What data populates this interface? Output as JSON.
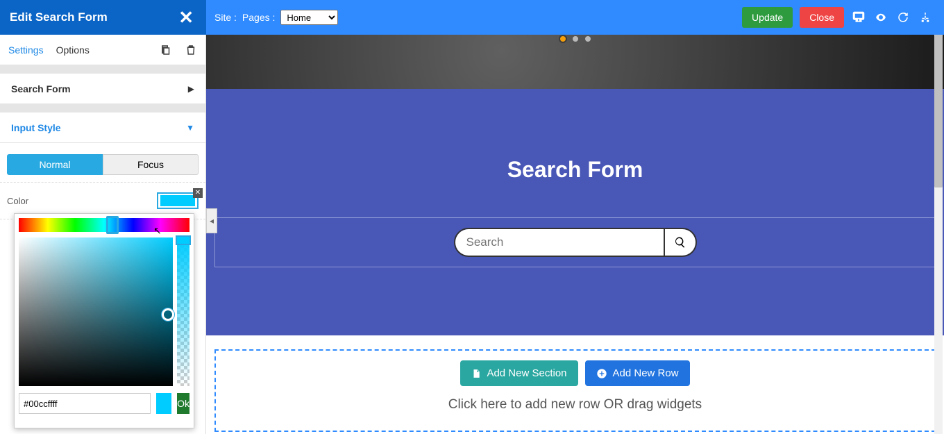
{
  "topbar": {
    "panel_title": "Edit Search Form",
    "site_label": "Site :",
    "pages_label": "Pages :",
    "page_select": "Home",
    "update_btn": "Update",
    "close_btn": "Close"
  },
  "left": {
    "tab_settings": "Settings",
    "tab_options": "Options",
    "section_search_form": "Search Form",
    "section_input_style": "Input Style",
    "seg_normal": "Normal",
    "seg_focus": "Focus",
    "color_label": "Color",
    "picker": {
      "hex": "#00ccffff",
      "color": "#00ccff",
      "ok": "Ok"
    }
  },
  "canvas": {
    "module_title": "Search Form",
    "search_placeholder": "Search",
    "btn_add_section": "Add New Section",
    "btn_add_row": "Add New Row",
    "drop_hint": "Click here to add new row OR drag widgets"
  }
}
